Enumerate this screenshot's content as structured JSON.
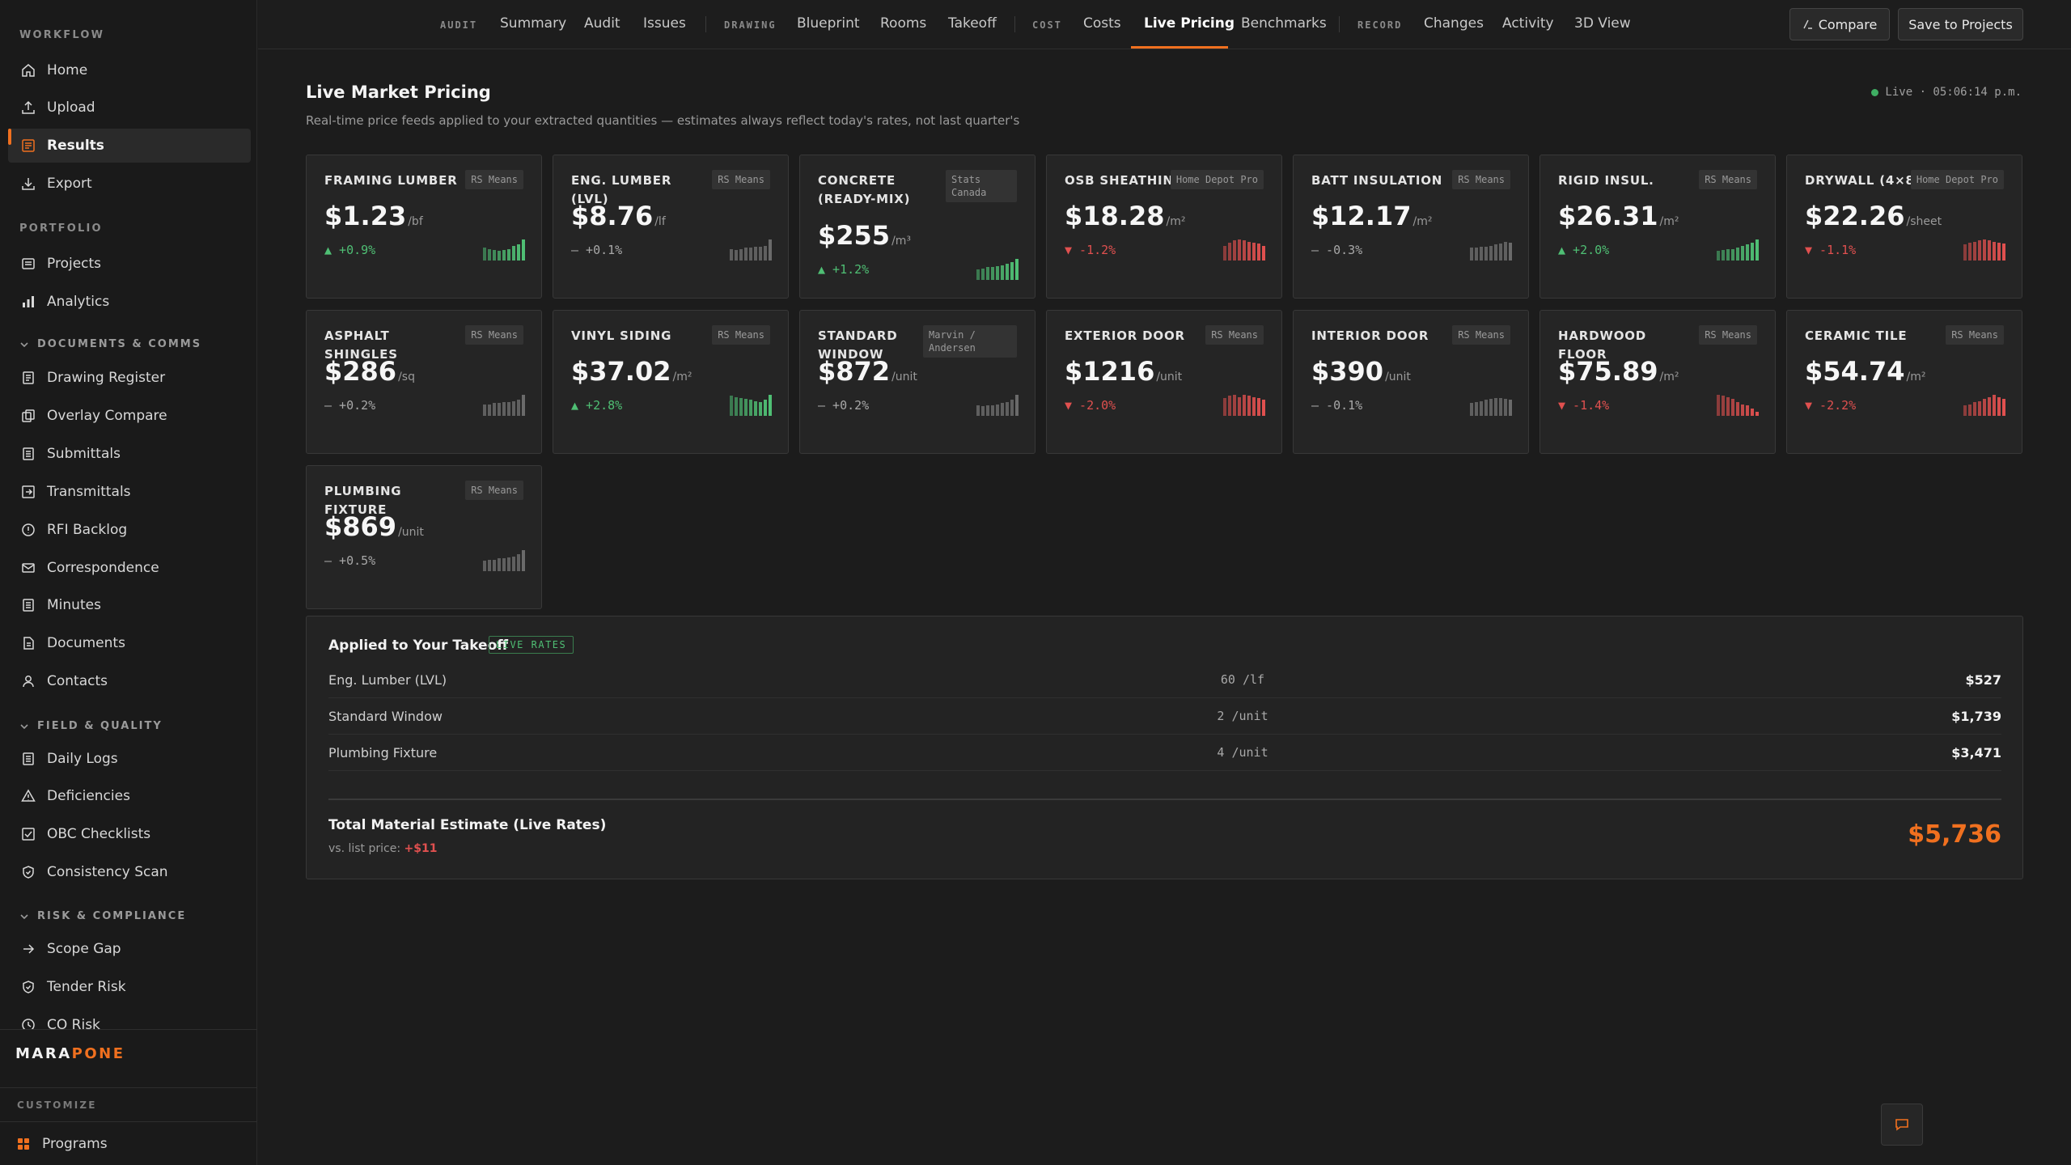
{
  "sidebar": {
    "workflow_label": "WORKFLOW",
    "workflow": [
      {
        "label": "Home",
        "icon": "home-icon"
      },
      {
        "label": "Upload",
        "icon": "upload-icon"
      },
      {
        "label": "Results",
        "icon": "results-icon",
        "active": true
      },
      {
        "label": "Export",
        "icon": "export-icon"
      }
    ],
    "portfolio_label": "PORTFOLIO",
    "portfolio": [
      {
        "label": "Projects",
        "icon": "projects-icon"
      },
      {
        "label": "Analytics",
        "icon": "analytics-icon"
      }
    ],
    "docs_label": "DOCUMENTS & COMMS",
    "docs": [
      {
        "label": "Drawing Register"
      },
      {
        "label": "Overlay Compare"
      },
      {
        "label": "Submittals"
      },
      {
        "label": "Transmittals"
      },
      {
        "label": "RFI Backlog"
      },
      {
        "label": "Correspondence"
      },
      {
        "label": "Minutes"
      },
      {
        "label": "Documents"
      },
      {
        "label": "Contacts"
      }
    ],
    "field_label": "FIELD & QUALITY",
    "field": [
      {
        "label": "Daily Logs"
      },
      {
        "label": "Deficiencies"
      },
      {
        "label": "OBC Checklists"
      },
      {
        "label": "Consistency Scan"
      }
    ],
    "risk_label": "RISK & COMPLIANCE",
    "risk": [
      {
        "label": "Scope Gap"
      },
      {
        "label": "Tender Risk"
      },
      {
        "label": "CO Risk"
      }
    ],
    "brand_a": "MARA",
    "brand_b": "PONE",
    "customize_label": "CUSTOMIZE",
    "programs_label": "Programs"
  },
  "topnav": {
    "audit_sec": "AUDIT",
    "summary": "Summary",
    "audit": "Audit",
    "issues": "Issues",
    "drawing_sec": "DRAWING",
    "blueprint": "Blueprint",
    "rooms": "Rooms",
    "takeoff": "Takeoff",
    "cost_sec": "COST",
    "costs": "Costs",
    "live_pricing": "Live Pricing",
    "benchmarks": "Benchmarks",
    "record_sec": "RECORD",
    "changes": "Changes",
    "activity": "Activity",
    "view3d": "3D View",
    "compare": "Compare",
    "save": "Save to Projects"
  },
  "page": {
    "title": "Live Market Pricing",
    "subtitle": "Real-time price feeds applied to your extracted quantities — estimates always reflect today's rates, not last quarter's",
    "live_text": "Live · 05:06:14 p.m."
  },
  "colors": {
    "accent": "#f0701f",
    "up": "#4fbf74",
    "down": "#e0504f",
    "flat": "#a8a8a8"
  },
  "cards": [
    {
      "name": "FRAMING LUMBER",
      "source": "RS Means",
      "price": "$1.23",
      "unit": "/bf",
      "change": "▲ +0.9%",
      "trend": "up",
      "spark": [
        0.6,
        0.55,
        0.5,
        0.45,
        0.5,
        0.55,
        0.7,
        0.75,
        1.0
      ]
    },
    {
      "name": "ENG. LUMBER (LVL)",
      "source": "RS Means",
      "price": "$8.76",
      "unit": "/lf",
      "change": "— +0.1%",
      "trend": "flat",
      "spark": [
        0.55,
        0.5,
        0.55,
        0.6,
        0.6,
        0.65,
        0.65,
        0.7,
        1.0
      ]
    },
    {
      "name": "CONCRETE (READY-MIX)",
      "source": "Stats Canada",
      "price": "$255",
      "unit": "/m³",
      "change": "▲ +1.2%",
      "trend": "up",
      "spark": [
        0.5,
        0.55,
        0.6,
        0.6,
        0.65,
        0.7,
        0.75,
        0.85,
        1.0
      ]
    },
    {
      "name": "OSB SHEATHING",
      "source": "Home Depot Pro",
      "price": "$18.28",
      "unit": "/m²",
      "change": "▼ -1.2%",
      "trend": "down",
      "spark": [
        0.7,
        0.85,
        0.95,
        1.0,
        0.95,
        0.9,
        0.85,
        0.8,
        0.7
      ]
    },
    {
      "name": "BATT INSULATION",
      "source": "RS Means",
      "price": "$12.17",
      "unit": "/m²",
      "change": "— -0.3%",
      "trend": "flat",
      "spark": [
        0.6,
        0.6,
        0.65,
        0.65,
        0.7,
        0.75,
        0.8,
        0.9,
        0.85
      ]
    },
    {
      "name": "RIGID INSUL.",
      "source": "RS Means",
      "price": "$26.31",
      "unit": "/m²",
      "change": "▲ +2.0%",
      "trend": "up",
      "spark": [
        0.45,
        0.5,
        0.55,
        0.55,
        0.6,
        0.7,
        0.75,
        0.85,
        1.0
      ]
    },
    {
      "name": "DRYWALL (4×8)",
      "source": "Home Depot Pro",
      "price": "$22.26",
      "unit": "/sheet",
      "change": "▼ -1.1%",
      "trend": "down",
      "spark": [
        0.75,
        0.85,
        0.9,
        0.95,
        1.0,
        0.95,
        0.9,
        0.85,
        0.8
      ]
    },
    {
      "name": "ASPHALT SHINGLES",
      "source": "RS Means",
      "price": "$286",
      "unit": "/sq",
      "change": "— +0.2%",
      "trend": "flat",
      "spark": [
        0.55,
        0.55,
        0.6,
        0.6,
        0.65,
        0.65,
        0.7,
        0.75,
        1.0
      ]
    },
    {
      "name": "VINYL SIDING",
      "source": "RS Means",
      "price": "$37.02",
      "unit": "/m²",
      "change": "▲ +2.8%",
      "trend": "up",
      "spark": [
        0.95,
        0.9,
        0.85,
        0.8,
        0.75,
        0.7,
        0.65,
        0.75,
        1.0
      ]
    },
    {
      "name": "STANDARD WINDOW",
      "source": "Marvin / Andersen",
      "price": "$872",
      "unit": "/unit",
      "change": "— +0.2%",
      "trend": "flat",
      "spark": [
        0.5,
        0.45,
        0.5,
        0.5,
        0.55,
        0.6,
        0.65,
        0.75,
        1.0
      ]
    },
    {
      "name": "EXTERIOR DOOR",
      "source": "RS Means",
      "price": "$1216",
      "unit": "/unit",
      "change": "▼ -2.0%",
      "trend": "down",
      "spark": [
        0.85,
        0.95,
        1.0,
        0.9,
        1.0,
        0.95,
        0.9,
        0.85,
        0.75
      ]
    },
    {
      "name": "INTERIOR DOOR",
      "source": "RS Means",
      "price": "$390",
      "unit": "/unit",
      "change": "— -0.1%",
      "trend": "flat",
      "spark": [
        0.6,
        0.65,
        0.7,
        0.75,
        0.8,
        0.85,
        0.85,
        0.8,
        0.75
      ]
    },
    {
      "name": "HARDWOOD FLOOR",
      "source": "RS Means",
      "price": "$75.89",
      "unit": "/m²",
      "change": "▼ -1.4%",
      "trend": "down",
      "spark": [
        1.0,
        0.95,
        0.9,
        0.8,
        0.65,
        0.55,
        0.5,
        0.35,
        0.2
      ]
    },
    {
      "name": "CERAMIC TILE",
      "source": "RS Means",
      "price": "$54.74",
      "unit": "/m²",
      "change": "▼ -2.2%",
      "trend": "down",
      "spark": [
        0.5,
        0.55,
        0.65,
        0.7,
        0.8,
        0.9,
        1.0,
        0.9,
        0.8
      ]
    },
    {
      "name": "PLUMBING FIXTURE",
      "source": "RS Means",
      "price": "$869",
      "unit": "/unit",
      "change": "— +0.5%",
      "trend": "flat",
      "spark": [
        0.5,
        0.55,
        0.55,
        0.6,
        0.6,
        0.65,
        0.7,
        0.8,
        1.0
      ]
    }
  ],
  "takeoff": {
    "title": "Applied to Your Takeoff",
    "badge": "LIVE RATES",
    "rows": [
      {
        "name": "Eng. Lumber (LVL)",
        "qty": "60 /lf",
        "value": "$527"
      },
      {
        "name": "Standard Window",
        "qty": "2 /unit",
        "value": "$1,739"
      },
      {
        "name": "Plumbing Fixture",
        "qty": "4 /unit",
        "value": "$3,471"
      }
    ],
    "total_label": "Total Material Estimate (Live Rates)",
    "vs_label": "vs. list price:",
    "vs_value": "+$11",
    "total_value": "$5,736"
  }
}
